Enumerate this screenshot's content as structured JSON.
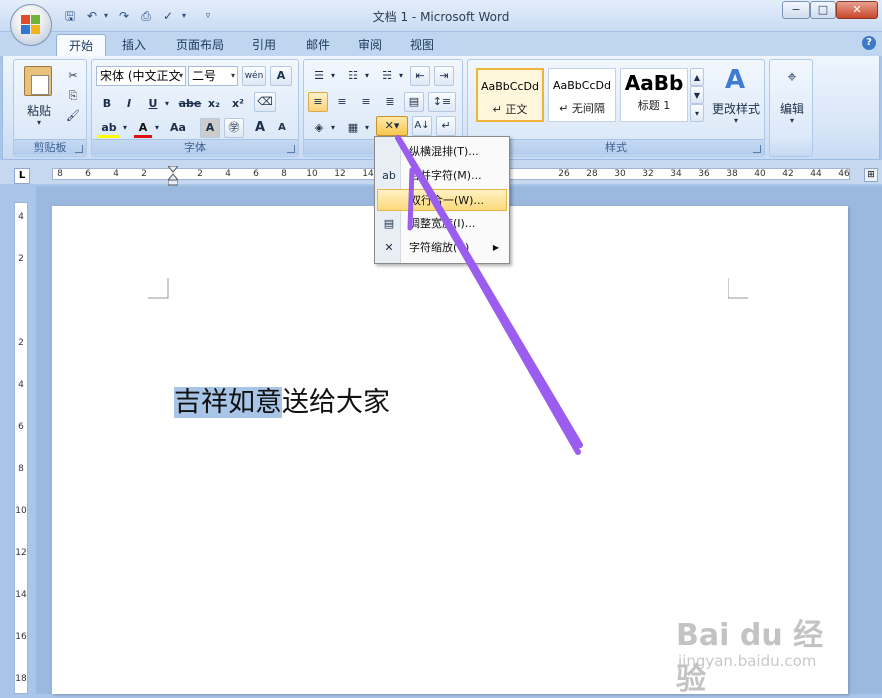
{
  "window": {
    "title": "文档 1 - Microsoft Word",
    "minimize": "−",
    "maximize": "□",
    "close": "✕"
  },
  "tabs": [
    {
      "label": "开始",
      "active": true
    },
    {
      "label": "插入"
    },
    {
      "label": "页面布局"
    },
    {
      "label": "引用"
    },
    {
      "label": "邮件"
    },
    {
      "label": "审阅"
    },
    {
      "label": "视图"
    }
  ],
  "ribbon": {
    "clipboard": {
      "label": "剪贴板",
      "paste": "粘贴"
    },
    "font": {
      "label": "字体",
      "font_name": "宋体 (中文正文",
      "font_size": "二号",
      "bold": "B",
      "italic": "I",
      "underline": "U",
      "strike": "abe",
      "subscript": "x₂",
      "superscript": "x²",
      "grow": "A",
      "shrink": "A",
      "case": "Aa",
      "phonetic": "wén",
      "clear": "A"
    },
    "paragraph": {
      "label": "段"
    },
    "styles": {
      "label": "样式",
      "items": [
        {
          "sample": "AaBbCcDd",
          "name": "↵ 正文"
        },
        {
          "sample": "AaBbCcDd",
          "name": "↵ 无间隔"
        },
        {
          "sample": "AaBb",
          "name": "标题 1"
        }
      ],
      "change_styles": "更改样式"
    },
    "editing": {
      "label": "编辑"
    }
  },
  "ruler": {
    "numbers": [
      "8",
      "6",
      "4",
      "2",
      "",
      "2",
      "4",
      "6",
      "8",
      "10",
      "12",
      "14",
      "",
      "",
      "",
      "",
      "",
      "",
      "26",
      "28",
      "30",
      "32",
      "34",
      "36",
      "38",
      "40",
      "42",
      "44",
      "46",
      "48"
    ]
  },
  "vruler": {
    "numbers": [
      "4",
      "2",
      "",
      "2",
      "4",
      "6",
      "8",
      "10",
      "12",
      "14",
      "16",
      "18"
    ]
  },
  "document": {
    "selected_text": "吉祥如意",
    "rest_text": "送给大家"
  },
  "menu": {
    "items": [
      {
        "label": "纵横混排(T)..."
      },
      {
        "label": "合并字符(M)..."
      },
      {
        "label": "双行合一(W)...",
        "highlight": true
      },
      {
        "label": "调整宽度(I)..."
      },
      {
        "label": "字符缩放(C)"
      }
    ]
  },
  "watermark": {
    "logo": "Bai du 经验",
    "url": "jingyan.baidu.com"
  },
  "colors": {
    "arrow": "#9b5cf0",
    "menu_highlight": "#fbd97b",
    "selection": "#a8c5e8"
  }
}
